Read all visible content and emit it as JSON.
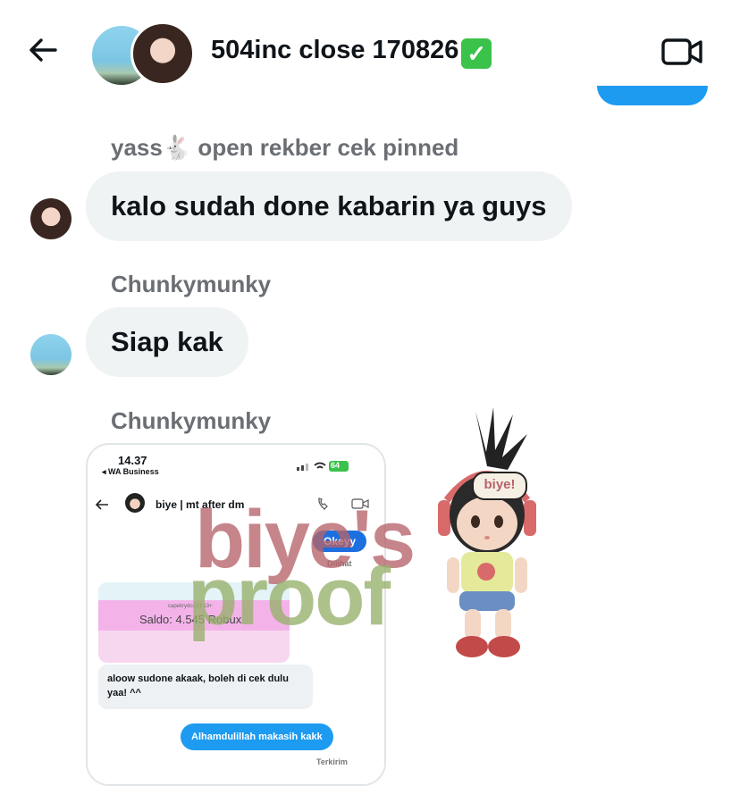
{
  "header": {
    "title": "504inc close 170826",
    "title_emoji": "✓"
  },
  "messages": [
    {
      "sender": "yass🐇 open rekber cek pinned",
      "text": "kalo sudah done kabarin ya guys"
    },
    {
      "sender": "Chunkymunky",
      "text": "Siap kak"
    },
    {
      "sender": "Chunkymunky"
    }
  ],
  "screenshot": {
    "time": "14.37",
    "carrier": "◂ WA Business",
    "battery": "64",
    "chat_name": "biye | mt after dm",
    "sent_bubble": "Okeyy",
    "seen_label": "Dilihat",
    "card_caption": "capekrydo123 13+",
    "saldo": "Saldo: 4.545 Robux",
    "received_bubble": "aloow sudone akaak, boleh di cek dulu yaa! ^^",
    "reply_bubble": "Alhamdulillah makasih kakk",
    "sent_status": "Terkirim"
  },
  "watermark": {
    "line1": "biye's",
    "line2": "proof",
    "sticker_label": "biye!"
  },
  "colors": {
    "accent": "#1d9bf0",
    "bubble_bg": "#eff3f4"
  }
}
